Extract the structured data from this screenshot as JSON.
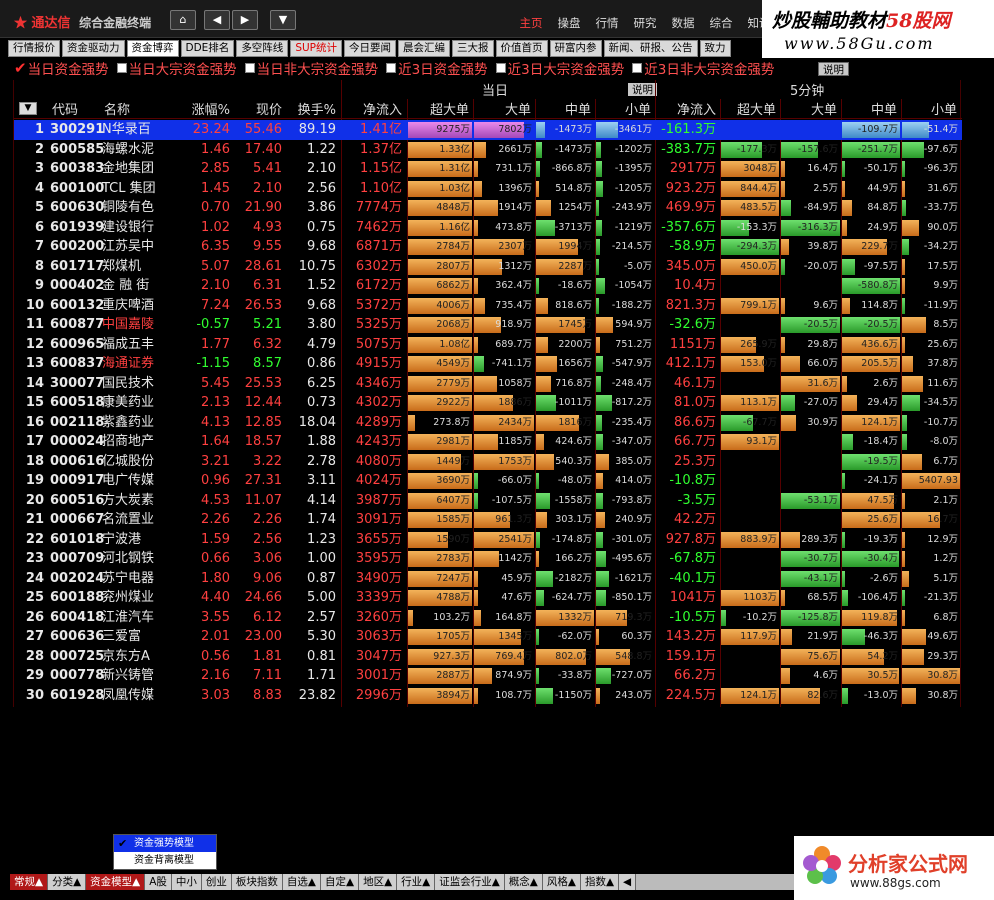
{
  "app": {
    "logo_stars": "★",
    "logo_name": "通达信",
    "logo_sub": "综合金融终端"
  },
  "topnav": {
    "home": "⌂",
    "back": "◀",
    "forward": "▶",
    "menu": "▼"
  },
  "topmenu": [
    "主页",
    "操盘",
    "行情",
    "研究",
    "数据",
    "综合",
    "知讯"
  ],
  "watermark_top": {
    "line1a": "炒股輔助教材",
    "line1b": "58股网",
    "line2": "www.58Gu.com"
  },
  "tabs": [
    "行情报价",
    "资金驱动力",
    "资金博弈",
    "DDE排名",
    "多空阵线",
    "SUP统计",
    "今日要闻",
    "晨会汇编",
    "三大报",
    "价值首页",
    "研富内参",
    "新闻、研报、公告",
    "致力"
  ],
  "tabs_active": 2,
  "tabs_red": 5,
  "models": [
    {
      "label": "当日资金强势",
      "checked": true
    },
    {
      "label": "当日大宗资金强势",
      "checked": false
    },
    {
      "label": "当日非大宗资金强势",
      "checked": false
    },
    {
      "label": "近3日资金强势",
      "checked": false
    },
    {
      "label": "近3日大宗资金强势",
      "checked": false
    },
    {
      "label": "近3日非大宗资金强势",
      "checked": false
    }
  ],
  "explain_label": "说明",
  "header": {
    "group_day": "当日",
    "group_5min": "5分钟",
    "explain": "说明",
    "cols": [
      "代码",
      "名称",
      "涨幅%",
      "现价",
      "换手%",
      "净流入",
      "超大单",
      "大单",
      "中单",
      "小单",
      "净流入",
      "超大单",
      "大单",
      "中单",
      "小单"
    ]
  },
  "rows": [
    {
      "n": "1",
      "code": "300291",
      "name": "N华录百",
      "pct": "23.24",
      "price": "55.46",
      "turn": "89.19",
      "net": "1.41亿",
      "c1": "9275万",
      "c2": "7802万",
      "c3": "-1473万",
      "c4": "-3461万",
      "net5": "-161.3万",
      "d1": "",
      "d2": "",
      "d3": "-109.7万",
      "d4": "-51.4万"
    },
    {
      "n": "2",
      "code": "600585",
      "name": "海螺水泥",
      "pct": "1.46",
      "price": "17.40",
      "turn": "1.22",
      "net": "1.37亿",
      "c1": "1.33亿",
      "c2": "2661万",
      "c3": "-1473万",
      "c4": "-1202万",
      "net5": "-383.7万",
      "d1": "-177.3万",
      "d2": "-157.6万",
      "d3": "-251.7万",
      "d4": "-97.6万"
    },
    {
      "n": "3",
      "code": "600383",
      "name": "金地集团",
      "pct": "2.85",
      "price": "5.41",
      "turn": "2.10",
      "net": "1.15亿",
      "c1": "1.31亿",
      "c2": "731.1万",
      "c3": "-866.8万",
      "c4": "-1395万",
      "net5": "2917万",
      "d1": "3048万",
      "d2": "16.4万",
      "d3": "-50.1万",
      "d4": "-96.3万"
    },
    {
      "n": "4",
      "code": "600100",
      "name": "TCL 集团",
      "pct": "1.45",
      "price": "2.10",
      "turn": "2.56",
      "net": "1.10亿",
      "c1": "1.03亿",
      "c2": "1396万",
      "c3": "514.8万",
      "c4": "-1205万",
      "net5": "923.2万",
      "d1": "844.4万",
      "d2": "2.5万",
      "d3": "44.9万",
      "d4": "31.6万"
    },
    {
      "n": "5",
      "code": "600630",
      "name": "铜陵有色",
      "pct": "0.70",
      "price": "21.90",
      "turn": "3.86",
      "net": "7774万",
      "c1": "4848万",
      "c2": "1914万",
      "c3": "1254万",
      "c4": "-243.9万",
      "net5": "469.9万",
      "d1": "483.5万",
      "d2": "-84.9万",
      "d3": "84.8万",
      "d4": "-33.7万"
    },
    {
      "n": "6",
      "code": "601939",
      "name": "建设银行",
      "pct": "1.02",
      "price": "4.93",
      "turn": "0.75",
      "net": "7462万",
      "c1": "1.16亿",
      "c2": "473.8万",
      "c3": "-3713万",
      "c4": "-1219万",
      "net5": "-357.6万",
      "d1": "-153.3万",
      "d2": "-316.3万",
      "d3": "24.9万",
      "d4": "90.0万"
    },
    {
      "n": "7",
      "code": "600200",
      "name": "江苏吴中",
      "pct": "6.35",
      "price": "9.55",
      "turn": "9.68",
      "net": "6871万",
      "c1": "2784万",
      "c2": "2307万",
      "c3": "1994万",
      "c4": "-214.5万",
      "net5": "-58.9万",
      "d1": "-294.3万",
      "d2": "39.8万",
      "d3": "229.7万",
      "d4": "-34.2万"
    },
    {
      "n": "8",
      "code": "601717",
      "name": "郑煤机",
      "pct": "5.07",
      "price": "28.61",
      "turn": "10.75",
      "net": "6302万",
      "c1": "2807万",
      "c2": "1312万",
      "c3": "2287万",
      "c4": "-5.0万",
      "net5": "345.0万",
      "d1": "450.0万",
      "d2": "-20.0万",
      "d3": "-97.5万",
      "d4": "17.5万"
    },
    {
      "n": "9",
      "code": "000402",
      "name": "金 融 街",
      "pct": "2.10",
      "price": "6.31",
      "turn": "1.52",
      "net": "6172万",
      "c1": "6862万",
      "c2": "362.4万",
      "c3": "-18.6万",
      "c4": "-1054万",
      "net5": "10.4万",
      "d1": "",
      "d2": "",
      "d3": "-580.8万",
      "d4": "9.9万"
    },
    {
      "n": "10",
      "code": "600132",
      "name": "重庆啤酒",
      "pct": "7.24",
      "price": "26.53",
      "turn": "9.68",
      "net": "5372万",
      "c1": "4006万",
      "c2": "735.4万",
      "c3": "818.6万",
      "c4": "-188.2万",
      "net5": "821.3万",
      "d1": "799.1万",
      "d2": "9.6万",
      "d3": "114.8万",
      "d4": "-11.9万"
    },
    {
      "n": "11",
      "code": "600877",
      "name": "中国嘉陵",
      "pct": "-0.57",
      "price": "5.21",
      "turn": "3.80",
      "net": "5325万",
      "c1": "2068万",
      "c2": "918.9万",
      "c3": "1745万",
      "c4": "594.9万",
      "net5": "-32.6万",
      "d1": "",
      "d2": "-20.5万",
      "d3": "-20.5万",
      "d4": "8.5万"
    },
    {
      "n": "12",
      "code": "600965",
      "name": "福成五丰",
      "pct": "1.77",
      "price": "6.32",
      "turn": "4.79",
      "net": "5075万",
      "c1": "1.08亿",
      "c2": "689.7万",
      "c3": "2200万",
      "c4": "751.2万",
      "net5": "1151万",
      "d1": "265.9万",
      "d2": "29.8万",
      "d3": "436.6万",
      "d4": "25.6万"
    },
    {
      "n": "13",
      "code": "600837",
      "name": "海通证券",
      "pct": "-1.15",
      "price": "8.57",
      "turn": "0.86",
      "net": "4915万",
      "c1": "4549万",
      "c2": "-741.1万",
      "c3": "1656万",
      "c4": "-547.9万",
      "net5": "412.1万",
      "d1": "153.0万",
      "d2": "66.0万",
      "d3": "205.5万",
      "d4": "37.8万"
    },
    {
      "n": "14",
      "code": "300077",
      "name": "国民技术",
      "pct": "5.45",
      "price": "25.53",
      "turn": "6.25",
      "net": "4346万",
      "c1": "2779万",
      "c2": "1058万",
      "c3": "716.8万",
      "c4": "-248.4万",
      "net5": "46.1万",
      "d1": "",
      "d2": "31.6万",
      "d3": "2.6万",
      "d4": "11.6万"
    },
    {
      "n": "15",
      "code": "600518",
      "name": "康美药业",
      "pct": "2.13",
      "price": "12.44",
      "turn": "0.73",
      "net": "4302万",
      "c1": "2922万",
      "c2": "1886万",
      "c3": "-1011万",
      "c4": "-817.2万",
      "net5": "81.0万",
      "d1": "113.1万",
      "d2": "-27.0万",
      "d3": "29.4万",
      "d4": "-34.5万"
    },
    {
      "n": "16",
      "code": "002118",
      "name": "紫鑫药业",
      "pct": "4.13",
      "price": "12.85",
      "turn": "18.04",
      "net": "4289万",
      "c1": "273.8万",
      "c2": "2434万",
      "c3": "1816万",
      "c4": "-235.4万",
      "net5": "86.6万",
      "d1": "-67.7万",
      "d2": "30.9万",
      "d3": "124.1万",
      "d4": "-10.7万"
    },
    {
      "n": "17",
      "code": "000024",
      "name": "招商地产",
      "pct": "1.64",
      "price": "18.57",
      "turn": "1.88",
      "net": "4243万",
      "c1": "2981万",
      "c2": "1185万",
      "c3": "424.6万",
      "c4": "-347.0万",
      "net5": "66.7万",
      "d1": "93.1万",
      "d2": "",
      "d3": "-18.4万",
      "d4": "-8.0万"
    },
    {
      "n": "18",
      "code": "000616",
      "name": "亿城股份",
      "pct": "3.21",
      "price": "3.22",
      "turn": "2.78",
      "net": "4080万",
      "c1": "1449万",
      "c2": "1753万",
      "c3": "540.3万",
      "c4": "385.0万",
      "net5": "25.3万",
      "d1": "",
      "d2": "",
      "d3": "-19.5万",
      "d4": "6.7万"
    },
    {
      "n": "19",
      "code": "000917",
      "name": "电广传媒",
      "pct": "0.96",
      "price": "27.31",
      "turn": "3.11",
      "net": "4024万",
      "c1": "3690万",
      "c2": "-66.0万",
      "c3": "-48.0万",
      "c4": "414.0万",
      "net5": "-10.8万",
      "d1": "",
      "d2": "",
      "d3": "-24.1万",
      "d4": "5407.93"
    },
    {
      "n": "20",
      "code": "600516",
      "name": "方大炭素",
      "pct": "4.53",
      "price": "11.07",
      "turn": "4.14",
      "net": "3987万",
      "c1": "6407万",
      "c2": "-107.5万",
      "c3": "-1558万",
      "c4": "-793.8万",
      "net5": "-3.5万",
      "d1": "",
      "d2": "-53.1万",
      "d3": "47.5万",
      "d4": "2.1万"
    },
    {
      "n": "21",
      "code": "000667",
      "name": "名流置业",
      "pct": "2.26",
      "price": "2.26",
      "turn": "1.74",
      "net": "3091万",
      "c1": "1585万",
      "c2": "961.3万",
      "c3": "303.1万",
      "c4": "240.9万",
      "net5": "42.2万",
      "d1": "",
      "d2": "",
      "d3": "25.6万",
      "d4": "16.7万"
    },
    {
      "n": "22",
      "code": "601018",
      "name": "宁波港",
      "pct": "1.59",
      "price": "2.56",
      "turn": "1.23",
      "net": "3655万",
      "c1": "1590万",
      "c2": "2541万",
      "c3": "-174.8万",
      "c4": "-301.0万",
      "net5": "927.8万",
      "d1": "883.9万",
      "d2": "289.3万",
      "d3": "-19.3万",
      "d4": "12.9万"
    },
    {
      "n": "23",
      "code": "000709",
      "name": "河北钢铁",
      "pct": "0.66",
      "price": "3.06",
      "turn": "1.00",
      "net": "3595万",
      "c1": "2783万",
      "c2": "1142万",
      "c3": "166.2万",
      "c4": "-495.6万",
      "net5": "-67.8万",
      "d1": "",
      "d2": "-30.7万",
      "d3": "-30.4万",
      "d4": "1.2万"
    },
    {
      "n": "24",
      "code": "002024",
      "name": "苏宁电器",
      "pct": "1.80",
      "price": "9.06",
      "turn": "0.87",
      "net": "3490万",
      "c1": "7247万",
      "c2": "45.9万",
      "c3": "-2182万",
      "c4": "-1621万",
      "net5": "-40.1万",
      "d1": "",
      "d2": "-43.1万",
      "d3": "-2.6万",
      "d4": "5.1万"
    },
    {
      "n": "25",
      "code": "600188",
      "name": "兖州煤业",
      "pct": "4.40",
      "price": "24.66",
      "turn": "5.00",
      "net": "3339万",
      "c1": "4788万",
      "c2": "47.6万",
      "c3": "-624.7万",
      "c4": "-850.1万",
      "net5": "1041万",
      "d1": "1103万",
      "d2": "68.5万",
      "d3": "-106.4万",
      "d4": "-21.3万"
    },
    {
      "n": "26",
      "code": "600418",
      "name": "江淮汽车",
      "pct": "3.55",
      "price": "6.12",
      "turn": "2.57",
      "net": "3260万",
      "c1": "103.2万",
      "c2": "164.8万",
      "c3": "1332万",
      "c4": "719.3万",
      "net5": "-10.5万",
      "d1": "-10.2万",
      "d2": "-125.8万",
      "d3": "119.8万",
      "d4": "6.8万"
    },
    {
      "n": "27",
      "code": "600636",
      "name": "三爱富",
      "pct": "2.01",
      "price": "23.00",
      "turn": "5.30",
      "net": "3063万",
      "c1": "1705万",
      "c2": "1345万",
      "c3": "-62.0万",
      "c4": "60.3万",
      "net5": "143.2万",
      "d1": "117.9万",
      "d2": "21.9万",
      "d3": "-46.3万",
      "d4": "49.6万"
    },
    {
      "n": "28",
      "code": "000725",
      "name": "京东方A",
      "pct": "0.56",
      "price": "1.81",
      "turn": "0.81",
      "net": "3047万",
      "c1": "927.3万",
      "c2": "769.4万",
      "c3": "802.0万",
      "c4": "548.8万",
      "net5": "159.1万",
      "d1": "",
      "d2": "75.6万",
      "d3": "54.2万",
      "d4": "29.3万"
    },
    {
      "n": "29",
      "code": "000778",
      "name": "新兴铸管",
      "pct": "2.16",
      "price": "7.11",
      "turn": "1.71",
      "net": "3001万",
      "c1": "2887万",
      "c2": "874.9万",
      "c3": "-33.8万",
      "c4": "-727.0万",
      "net5": "66.2万",
      "d1": "",
      "d2": "4.6万",
      "d3": "30.5万",
      "d4": "30.8万"
    },
    {
      "n": "30",
      "code": "601928",
      "name": "凤凰传媒",
      "pct": "3.03",
      "price": "8.83",
      "turn": "23.82",
      "net": "2996万",
      "c1": "3894万",
      "c2": "108.7万",
      "c3": "-1150万",
      "c4": "243.0万",
      "net5": "224.5万",
      "d1": "124.1万",
      "d2": "82.6万",
      "d3": "-13.0万",
      "d4": "30.8万"
    }
  ],
  "popup": {
    "items": [
      "资金强势模型",
      "资金背离模型"
    ],
    "checked": 0
  },
  "bottombar": [
    "常规▲",
    "分类▲",
    "资金模型▲",
    "A股",
    "中小",
    "创业",
    "板块指数",
    "自选▲",
    "自定▲",
    "地区▲",
    "行业▲",
    "证监会行业▲",
    "概念▲",
    "风格▲",
    "指数▲",
    "◀"
  ],
  "bottombar_red": [
    0,
    2
  ],
  "watermark_bottom": {
    "line1": "分析家公式网",
    "line2": "www.88gs.com"
  },
  "colors": {
    "up": "#ff4040",
    "down": "#30ff30",
    "bar_orange": "#e8962e",
    "bar_green": "#3cc03c",
    "selected": "#1030e8"
  }
}
